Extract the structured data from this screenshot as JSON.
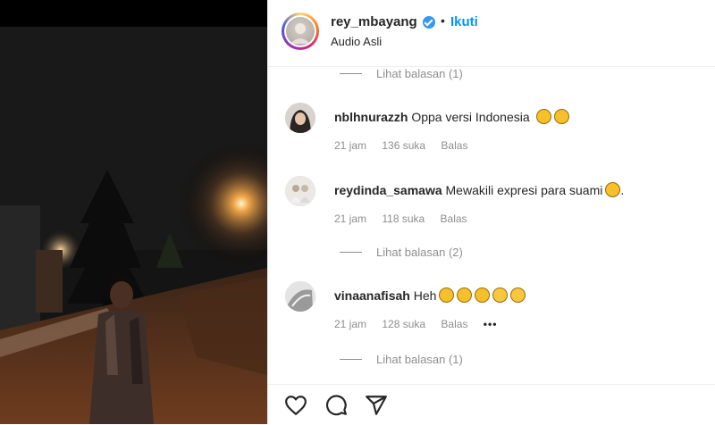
{
  "post": {
    "username": "rey_mbayang",
    "separator": "•",
    "follow_label": "Ikuti",
    "subtitle": "Audio Asli"
  },
  "comments": [
    {
      "username": "nblhnurazzh",
      "text": "Oppa versi Indonesia",
      "emojis": [
        "heart-eyes-emoji",
        "heart-eyes-emoji"
      ],
      "time": "21 jam",
      "likes": "136 suka",
      "reply": "Balas"
    },
    {
      "username": "reydinda_samawa",
      "text": "Mewakili expresi para suami",
      "emojis": [
        "grin-sweat-emoji"
      ],
      "suffix": ".",
      "time": "21 jam",
      "likes": "118 suka",
      "reply": "Balas"
    },
    {
      "username": "vinaanafisah",
      "text": "Heh",
      "emojis": [
        "rofl-emoji",
        "rofl-emoji",
        "rofl-emoji",
        "crying-emoji",
        "crying-emoji"
      ],
      "time": "21 jam",
      "likes": "128 suka",
      "reply": "Balas",
      "more": "•••"
    }
  ],
  "view_replies": [
    "Lihat balasan (1)",
    "Lihat balasan (2)",
    "Lihat balasan (1)"
  ],
  "icons": {
    "like": "heart-icon",
    "comment": "comment-icon",
    "share": "share-icon"
  },
  "colors": {
    "accent": "#0095f6",
    "verified": "#3897f0",
    "text": "#262626",
    "muted": "#8e8e8e"
  }
}
